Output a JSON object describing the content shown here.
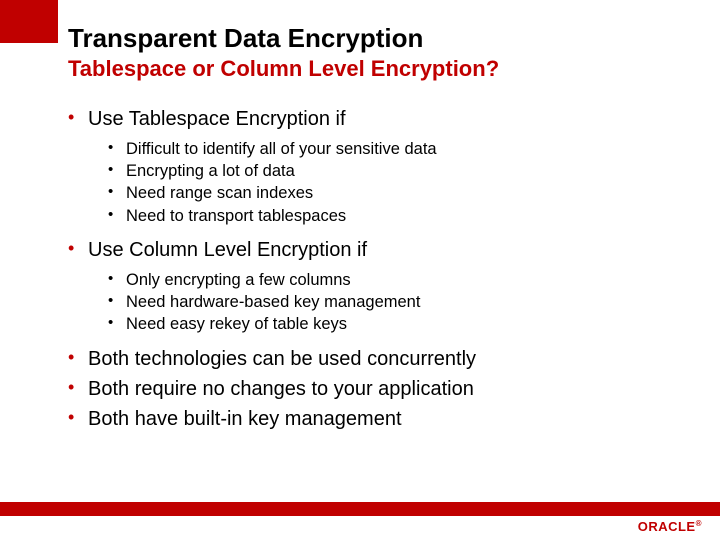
{
  "title": "Transparent Data Encryption",
  "subtitle": "Tablespace or Column Level Encryption?",
  "bullets": [
    {
      "text": "Use Tablespace Encryption if",
      "sub": [
        "Difficult to identify all of your sensitive data",
        "Encrypting a lot of data",
        "Need range scan indexes",
        "Need to transport tablespaces"
      ]
    },
    {
      "text": "Use Column Level Encryption if",
      "sub": [
        "Only encrypting a few columns",
        "Need hardware-based key management",
        "Need easy rekey of table keys"
      ]
    },
    {
      "text": "Both technologies can be used concurrently",
      "sub": []
    },
    {
      "text": "Both require no changes to your application",
      "sub": []
    },
    {
      "text": "Both have built-in key management",
      "sub": []
    }
  ],
  "logo": "ORACLE"
}
